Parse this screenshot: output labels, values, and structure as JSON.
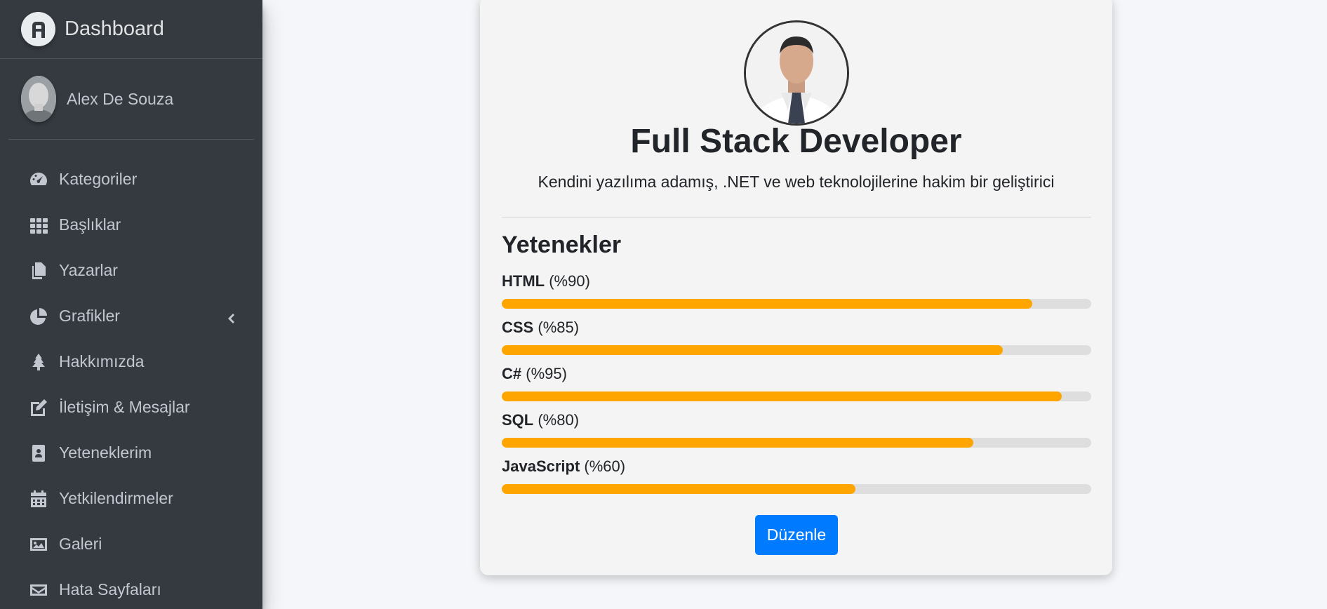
{
  "brand": {
    "title": "Dashboard",
    "icon": "brand-logo-icon"
  },
  "user": {
    "name": "Alex De Souza"
  },
  "sidebar": {
    "items": [
      {
        "label": "Kategoriler",
        "icon": "tachometer-icon"
      },
      {
        "label": "Başlıklar",
        "icon": "grid-icon"
      },
      {
        "label": "Yazarlar",
        "icon": "copy-icon"
      },
      {
        "label": "Grafikler",
        "icon": "pie-chart-icon",
        "has_submenu": true
      },
      {
        "label": "Hakkımızda",
        "icon": "tree-icon"
      },
      {
        "label": "İletişim & Mesajlar",
        "icon": "edit-icon"
      },
      {
        "label": "Yeteneklerim",
        "icon": "id-badge-icon"
      },
      {
        "label": "Yetkilendirmeler",
        "icon": "calendar-icon"
      },
      {
        "label": "Galeri",
        "icon": "image-icon"
      },
      {
        "label": "Hata Sayfaları",
        "icon": "envelope-icon"
      }
    ]
  },
  "profile": {
    "title": "Full Stack Developer",
    "description": "Kendini yazılıma adamış, .NET ve web teknolojilerine hakim bir geliştirici"
  },
  "skills": {
    "heading": "Yetenekler",
    "items": [
      {
        "name": "HTML",
        "percent_text": "(%90)",
        "value": 90
      },
      {
        "name": "CSS",
        "percent_text": "(%85)",
        "value": 85
      },
      {
        "name": "C#",
        "percent_text": "(%95)",
        "value": 95
      },
      {
        "name": "SQL",
        "percent_text": "(%80)",
        "value": 80
      },
      {
        "name": "JavaScript",
        "percent_text": "(%60)",
        "value": 60
      }
    ]
  },
  "actions": {
    "edit_label": "Düzenle"
  },
  "colors": {
    "sidebar_bg": "#343a40",
    "progress": "#ffa500",
    "primary_button": "#007bff",
    "page_bg": "#f4f6f9"
  }
}
